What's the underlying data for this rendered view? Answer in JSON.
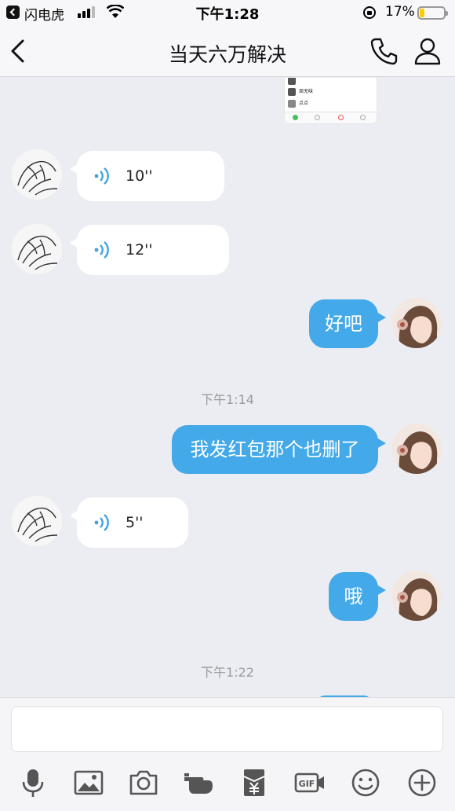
{
  "status_bar": {
    "back_app": "闪电虎",
    "time": "下午1:28",
    "battery": "17%"
  },
  "nav": {
    "title": "当天六万解决"
  },
  "thumbnail": {
    "rows": [
      "周无味",
      "点点"
    ]
  },
  "messages": [
    {
      "kind": "voice-in",
      "duration": "10''"
    },
    {
      "kind": "voice-in",
      "duration": "12''"
    },
    {
      "kind": "text-out",
      "text": "好吧"
    },
    {
      "kind": "time",
      "text": "下午1:14"
    },
    {
      "kind": "text-out",
      "text": "我发红包那个也删了"
    },
    {
      "kind": "voice-in",
      "duration": "5''"
    },
    {
      "kind": "text-out",
      "text": "哦"
    },
    {
      "kind": "time",
      "text": "下午1:22"
    }
  ],
  "input": {
    "placeholder": ""
  },
  "toolbar_icons": [
    "microphone-icon",
    "image-icon",
    "camera-icon",
    "poke-hand-icon",
    "red-packet-icon",
    "gif-icon",
    "emoji-icon",
    "plus-icon"
  ],
  "colors": {
    "accent": "#43a9e8",
    "background": "#ebedf2",
    "voice_wave": "#3ea3e0"
  }
}
